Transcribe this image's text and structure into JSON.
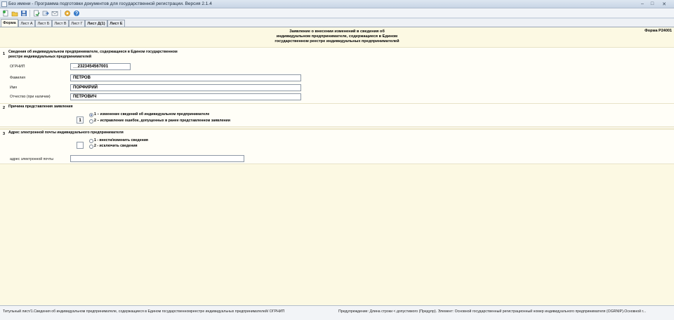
{
  "window": {
    "title": "Без имени - Программа подготовки документов для государственной регистрации. Версия 2.1.4",
    "minimize_glyph": "–",
    "maximize_glyph": "□",
    "close_glyph": "✕"
  },
  "toolbar": {
    "icons": [
      "new-document-icon",
      "open-folder-icon",
      "save-icon",
      "check-document-icon",
      "send-icon",
      "email-icon",
      "settings-gear-icon",
      "help-icon"
    ]
  },
  "tabs": [
    {
      "label": "Форма",
      "active": true
    },
    {
      "label": "Лист А"
    },
    {
      "label": "Лист Б"
    },
    {
      "label": "Лист В"
    },
    {
      "label": "Лист Г"
    },
    {
      "label": "Лист Д(1)"
    },
    {
      "label": "Лист Е"
    }
  ],
  "form": {
    "code": "Форма Р24001",
    "heading": [
      "Заявление о внесении изменений в сведения об",
      "индивидуальном предпринимателе, содержащиеся в Едином",
      "государственном реестре индивидуальных предпринимателей"
    ],
    "section1": {
      "number": "1",
      "title": [
        "Сведения об индивидуальном предпринимателе, содержащиеся в Едином государственном",
        "реестре индивидуальных предпринимателей"
      ],
      "ogrnip_label": "ОГРНИП",
      "ogrnip_value": "__2323454567001",
      "surname_label": "Фамилия",
      "surname_value": "ПЕТРОВ",
      "name_label": "Имя",
      "name_value": "ПОРФИРИЙ",
      "patronymic_label": "Отчество (при наличии)",
      "patronymic_value": "ПЕТРОВИЧ"
    },
    "section2": {
      "number": "2",
      "title": "Причина представления заявления",
      "code_value": "1",
      "option1": "1 – изменение сведений об индивидуальном предпринимателе",
      "option2": "2 – исправление ошибок, допущенных в ранее представленном заявлении"
    },
    "section3": {
      "number": "3",
      "title": "Адрес электронной почты индивидуального предпринимателя",
      "code_value": "",
      "option1": "1 - внести/изменить сведения",
      "option2": "2 - исключить сведения",
      "email_label": "адрес электронной почты",
      "email_value": ""
    }
  },
  "status": {
    "left": "Титульный лист/1.Сведения об индивидуальном предпринимателе, содержащиеся в Едином государственномреестре индивидуальных предпринимателей/ ОГРНИП",
    "right": "Предупреждение: Длина строки < допустимого (Предупр). Элемент: Основной государственный регистрационный номер индивидуального предпринимателя (OGRNIP).Основной г..."
  }
}
